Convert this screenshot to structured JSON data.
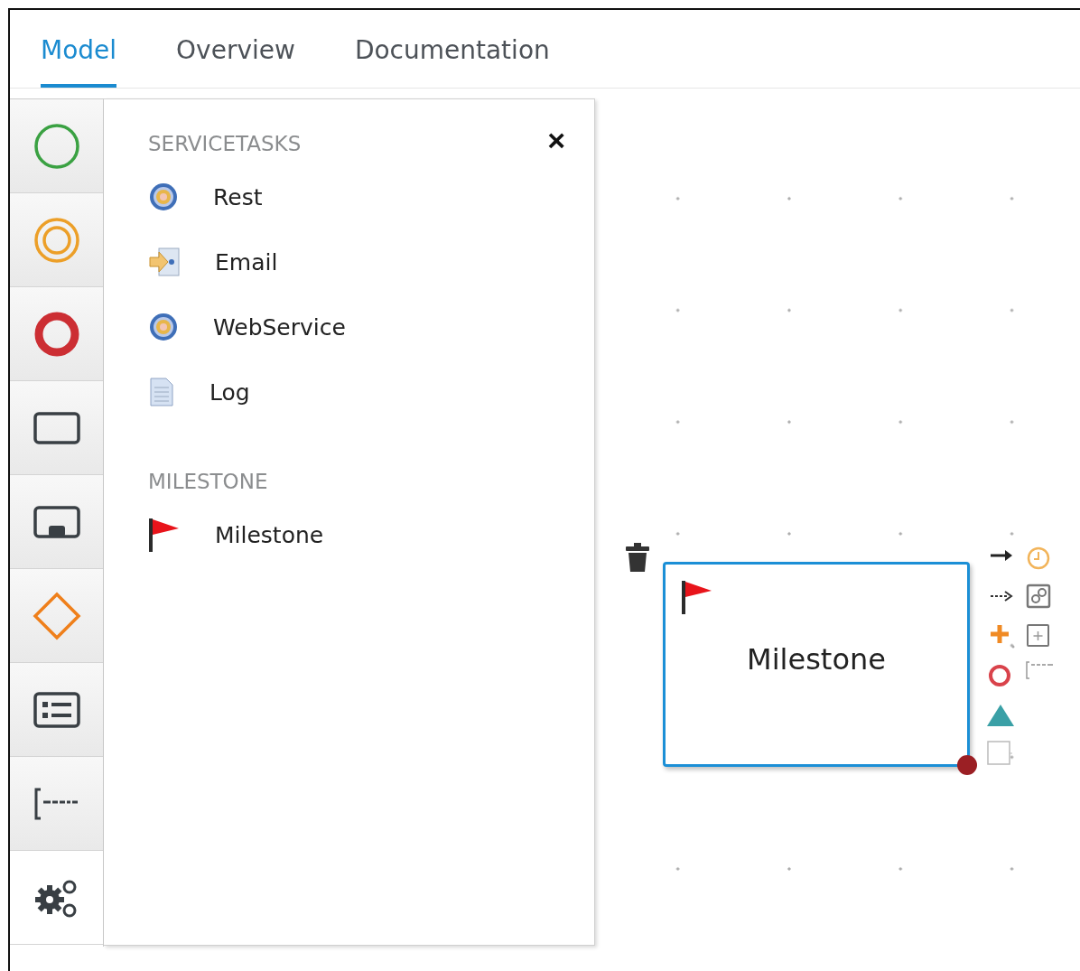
{
  "tabs": [
    {
      "label": "Model",
      "selected": true
    },
    {
      "label": "Overview",
      "selected": false
    },
    {
      "label": "Documentation",
      "selected": false
    }
  ],
  "toolbar": [
    {
      "kind": "start",
      "selected": false
    },
    {
      "kind": "intermediate",
      "selected": false
    },
    {
      "kind": "end",
      "selected": false
    },
    {
      "kind": "task",
      "selected": false
    },
    {
      "kind": "subprocess",
      "selected": false
    },
    {
      "kind": "gateway",
      "selected": false
    },
    {
      "kind": "container",
      "selected": false
    },
    {
      "kind": "annotation",
      "selected": false
    },
    {
      "kind": "custom",
      "selected": true
    }
  ],
  "palette": {
    "close": "×",
    "sections": [
      {
        "title": "SERVICETASKS",
        "items": [
          {
            "label": "Rest",
            "kind": "gear"
          },
          {
            "label": "Email",
            "kind": "email"
          },
          {
            "label": "WebService",
            "kind": "gear"
          },
          {
            "label": "Log",
            "kind": "log"
          }
        ]
      },
      {
        "title": "MILESTONE",
        "items": [
          {
            "label": "Milestone",
            "kind": "flag"
          }
        ]
      }
    ]
  },
  "canvas": {
    "node": {
      "label": "Milestone",
      "kind": "flag",
      "selected": true
    }
  }
}
